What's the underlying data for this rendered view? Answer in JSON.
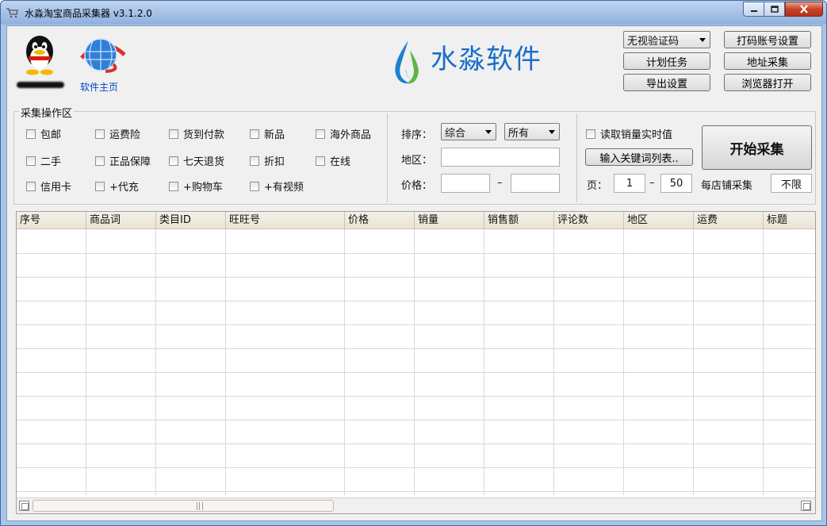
{
  "window": {
    "title": "水淼淘宝商品采集器 v3.1.2.0"
  },
  "header": {
    "home_link": "软件主页",
    "logo_text": "水淼软件",
    "captcha_select": "无视验证码",
    "buttons": {
      "captcha_account": "打码账号设置",
      "schedule": "计划任务",
      "address_collect": "地址采集",
      "export_settings": "导出设置",
      "browser_open": "浏览器打开"
    }
  },
  "ops": {
    "title": "采集操作区",
    "checkboxes": [
      "包邮",
      "运费险",
      "货到付款",
      "新品",
      "海外商品",
      "二手",
      "正品保障",
      "七天退货",
      "折扣",
      "在线",
      "信用卡",
      "+代充",
      "+购物车",
      "+有视频"
    ]
  },
  "filters": {
    "sort_label": "排序：",
    "sort_value": "综合",
    "scope_value": "所有",
    "region_label": "地区：",
    "region_value": "",
    "price_label": "价格：",
    "price_min": "",
    "price_dash": "–",
    "price_max": ""
  },
  "collect": {
    "realtime_sales": "读取销量实时值",
    "keyword_list_btn": "输入关键词列表..",
    "page_label": "页：",
    "page_from": "1",
    "page_dash": "–",
    "page_to": "50",
    "per_shop_label": "每店铺采集",
    "per_shop_value": "不限",
    "start_btn": "开始采集"
  },
  "table": {
    "columns": [
      "序号",
      "商品词",
      "类目ID",
      "旺旺号",
      "价格",
      "销量",
      "销售额",
      "评论数",
      "地区",
      "运费",
      "标题"
    ],
    "rows": []
  },
  "colors": {
    "logo_blue": "#1a6ec8",
    "link_blue": "#0645c8",
    "close_red": "#c7422a"
  }
}
